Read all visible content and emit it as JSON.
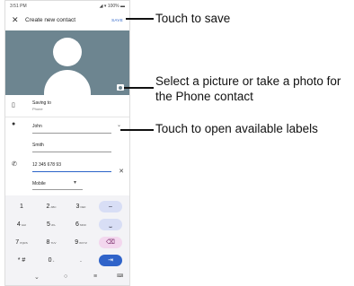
{
  "status_bar": {
    "time": "3:51 PM",
    "battery": "100%"
  },
  "app_bar": {
    "title": "Create new contact",
    "save_label": "SAVE"
  },
  "saving": {
    "label": "Saving to",
    "value": "Phone"
  },
  "name": {
    "first": "John",
    "last": "Smith"
  },
  "phone": {
    "number": "12 345 678 93",
    "label_type": "Mobile"
  },
  "keyboard": {
    "rows": [
      [
        {
          "main": "1",
          "sub": ""
        },
        {
          "main": "2",
          "sub": "ABC"
        },
        {
          "main": "3",
          "sub": "DEF"
        },
        {
          "main": "–",
          "sub": ""
        }
      ],
      [
        {
          "main": "4",
          "sub": "GHI"
        },
        {
          "main": "5",
          "sub": "JKL"
        },
        {
          "main": "6",
          "sub": "MNO"
        },
        {
          "main": "⎵",
          "sub": ""
        }
      ],
      [
        {
          "main": "7",
          "sub": "PQRS"
        },
        {
          "main": "8",
          "sub": "TUV"
        },
        {
          "main": "9",
          "sub": "WXYZ"
        },
        {
          "main": "⌫",
          "sub": ""
        }
      ],
      [
        {
          "main": "* #",
          "sub": ""
        },
        {
          "main": "0",
          "sub": "+"
        },
        {
          "main": ".",
          "sub": ""
        },
        {
          "main": "⇥",
          "sub": ""
        }
      ]
    ]
  },
  "callouts": {
    "save": "Touch to save",
    "photo": "Select a picture or take a photo for the Phone contact",
    "labels": "Touch to open available labels"
  }
}
